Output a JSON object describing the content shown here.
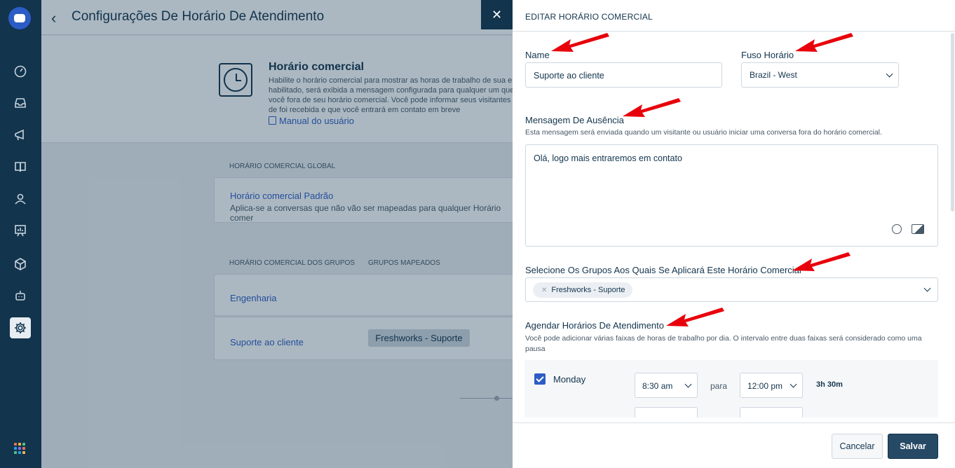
{
  "page": {
    "title": "Configurações De Horário De Atendimento",
    "hero_title": "Horário comercial",
    "hero_desc": "Habilite o horário comercial para mostrar as horas de trabalho de sua em habilitado, será exibida a mensagem configurada para qualquer um que e você fora de seu horário comercial. Você pode informar seus visitantes de foi recebida e que você entrará em contato em breve",
    "manual_link": "Manual do usuário",
    "global_section": "HORÁRIO COMERCIAL GLOBAL",
    "global_item": "Horário comercial Padrão",
    "global_item_sub": "Aplica-se a conversas que não vão ser mapeadas para qualquer Horário comer",
    "groups_section": "HORÁRIO COMERCIAL DOS GRUPOS",
    "mapped_section": "GRUPOS MAPEADOS",
    "group_items": [
      {
        "name": "Engenharia",
        "tag": ""
      },
      {
        "name": "Suporte ao cliente",
        "tag": "Freshworks - Suporte"
      }
    ],
    "close": "✕"
  },
  "drawer": {
    "title": "EDITAR HORÁRIO COMERCIAL",
    "name_label": "Name",
    "name_value": "Suporte ao cliente",
    "tz_label": "Fuso Horário",
    "tz_value": "Brazil - West",
    "away_label": "Mensagem De Ausência",
    "away_help": "Esta mensagem será enviada quando um visitante ou usuário iniciar uma conversa fora do horário comercial.",
    "away_value": "Olá, logo mais entraremos em contato",
    "groups_label": "Selecione Os Grupos Aos Quais Se Aplicará Este Horário Comercial",
    "groups_chip": "Freshworks - Suporte",
    "sched_label": "Agendar Horários De Atendimento",
    "sched_help": "Você pode adicionar várias faixas de horas de trabalho por dia. O intervalo entre duas faixas será considerado como uma pausa",
    "schedule": {
      "day": "Monday",
      "from": "8:30 am",
      "sep": "para",
      "to": "12:00 pm",
      "duration": "3h 30m"
    },
    "cancel": "Cancelar",
    "save": "Salvar"
  },
  "colors": {
    "nav": "#12344d",
    "accent": "#2c5cc5",
    "arrow": "#e8000b",
    "save_button": "#264966"
  },
  "icons": [
    "home-icon",
    "inbox-icon",
    "megaphone-icon",
    "book-icon",
    "user-icon",
    "reports-icon",
    "cube-icon",
    "bot-icon",
    "gear-icon",
    "apps-icon",
    "emoji-icon",
    "image-icon",
    "close-icon",
    "back-icon",
    "clock-icon"
  ]
}
